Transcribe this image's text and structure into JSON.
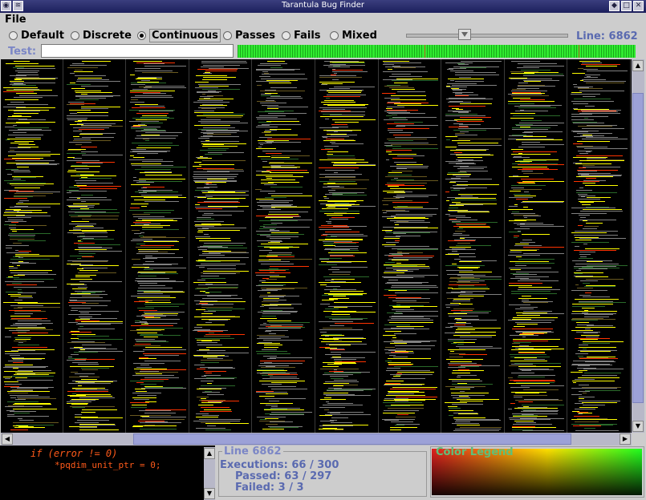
{
  "window": {
    "title": "Tarantula Bug Finder"
  },
  "menu": {
    "file": "File"
  },
  "modes": [
    {
      "label": "Default",
      "selected": false
    },
    {
      "label": "Discrete",
      "selected": false
    },
    {
      "label": "Continuous",
      "selected": true
    },
    {
      "label": "Passes",
      "selected": false
    },
    {
      "label": "Fails",
      "selected": false
    },
    {
      "label": "Mixed",
      "selected": false
    }
  ],
  "slider": {
    "line_label": "Line: 6862",
    "position_fraction": 0.35
  },
  "test": {
    "label": "Test:",
    "value": ""
  },
  "code": {
    "line1": "if (error != 0)",
    "line2": "*pqdim_unit_ptr = 0;"
  },
  "info": {
    "title": "Line 6862",
    "executions": "Executions: 66 / 300",
    "passed": "Passed: 63 / 297",
    "failed": "Failed: 3 / 3"
  },
  "legend": {
    "title": "Color Legend"
  },
  "colors": {
    "pass": "#30ec30",
    "suspicious": "#ffff00",
    "fail": "#ff3300",
    "neutral": "#808080"
  }
}
